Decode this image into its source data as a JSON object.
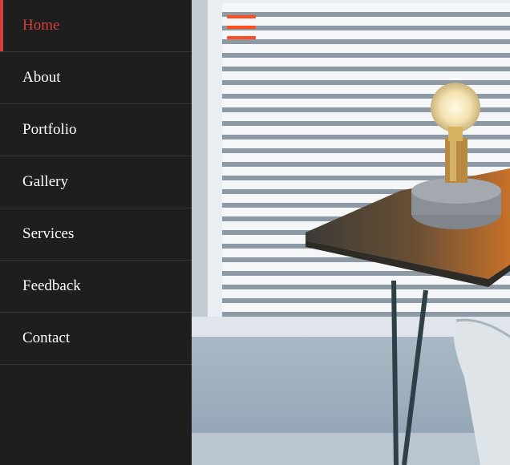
{
  "nav": {
    "items": [
      {
        "label": "Home",
        "active": true
      },
      {
        "label": "About"
      },
      {
        "label": "Portfolio"
      },
      {
        "label": "Gallery"
      },
      {
        "label": "Services"
      },
      {
        "label": "Feedback"
      },
      {
        "label": "Contact"
      }
    ],
    "active_color": "#d43f3a",
    "background": "#1e1e1e"
  },
  "toggle": {
    "icon": "hamburger-menu-icon",
    "color": "#ff4d1f"
  },
  "hero": {
    "image": "window-with-blinds-table-and-lamp"
  }
}
